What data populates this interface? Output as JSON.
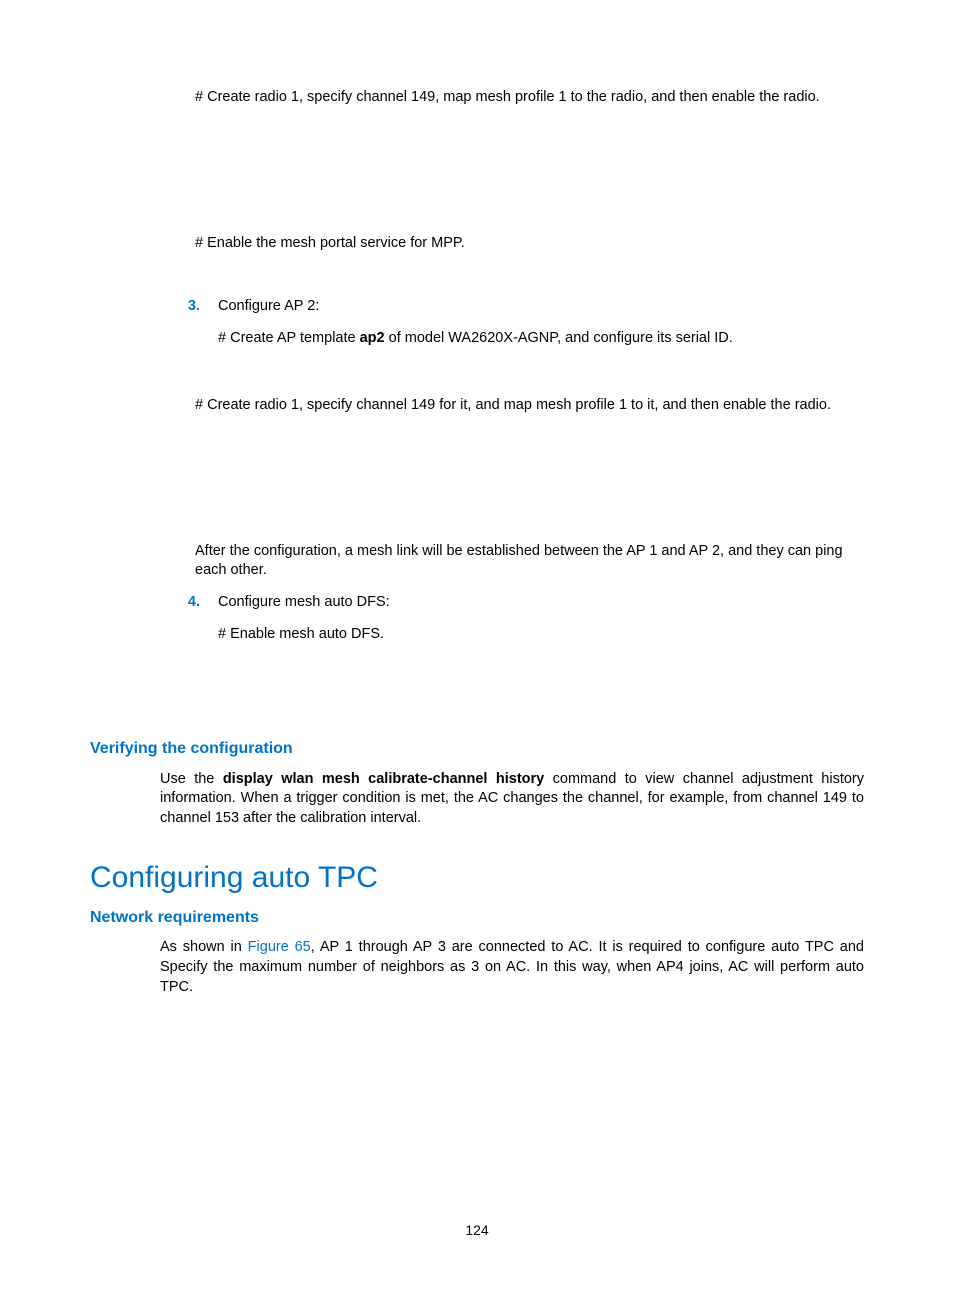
{
  "p1": "# Create radio 1, specify channel 149, map mesh profile 1 to the radio, and then enable the radio.",
  "p2": "# Enable the mesh portal service for MPP.",
  "item3_num": "3.",
  "item3_title": "Configure AP 2:",
  "item3_line1_prefix": "# Create AP template ",
  "item3_line1_bold": "ap2",
  "item3_line1_suffix": " of model WA2620X-AGNP, and configure its serial ID.",
  "item3_line2": "# Create radio 1, specify channel 149 for it, and map mesh profile 1 to it, and then enable the radio.",
  "item3_line3": "After the configuration, a mesh link will be established between the AP 1 and AP 2, and they can ping each other.",
  "item4_num": "4.",
  "item4_title": "Configure mesh auto DFS:",
  "item4_line1": "# Enable mesh auto DFS.",
  "h3_verify": "Verifying the configuration",
  "verify_p_prefix": "Use the ",
  "verify_p_bold": "display wlan mesh calibrate-channel history",
  "verify_p_suffix": " command to view channel adjustment history information. When a trigger condition is met, the AC changes the channel, for example, from channel 149 to channel 153 after the calibration interval.",
  "h2_tpc": "Configuring auto TPC",
  "h3_netreq": "Network requirements",
  "netreq_prefix": "As shown in ",
  "netreq_link": "Figure 65",
  "netreq_suffix": ", AP 1 through AP 3 are connected to AC. It is required to configure auto TPC and Specify the maximum number of neighbors as 3 on AC. In this way, when AP4 joins, AC will perform auto TPC.",
  "page_num": "124"
}
